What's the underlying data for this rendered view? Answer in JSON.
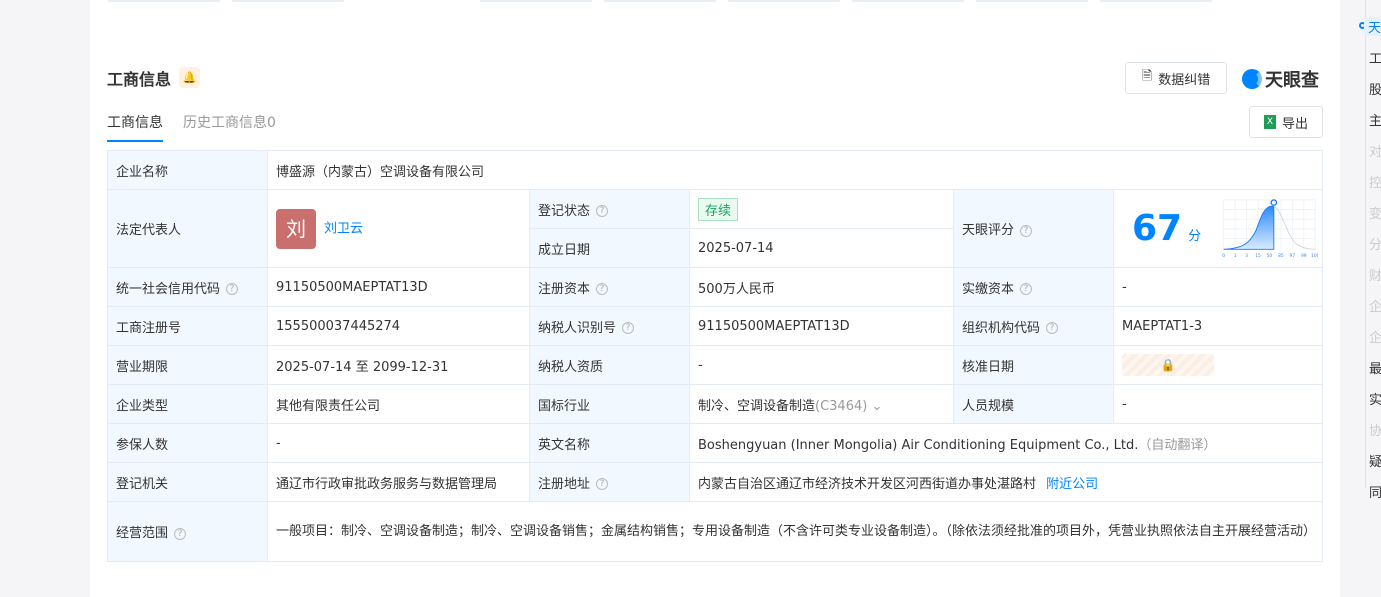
{
  "section": {
    "title": "工商信息",
    "correction_label": "数据纠错",
    "brand": "天眼查",
    "export_label": "导出"
  },
  "tabs": [
    {
      "label": "工商信息",
      "active": true
    },
    {
      "label": "历史工商信息0",
      "active": false
    }
  ],
  "info": {
    "company_name_label": "企业名称",
    "company_name": "博盛源（内蒙古）空调设备有限公司",
    "legal_rep_label": "法定代表人",
    "legal_rep_avatar": "刘",
    "legal_rep": "刘卫云",
    "reg_status_label": "登记状态",
    "reg_status": "存续",
    "found_date_label": "成立日期",
    "found_date": "2025-07-14",
    "score_label": "天眼评分",
    "score": "67",
    "score_unit": "分",
    "credit_code_label": "统一社会信用代码",
    "credit_code": "91150500MAEPTAT13D",
    "reg_capital_label": "注册资本",
    "reg_capital": "500万人民币",
    "paid_capital_label": "实缴资本",
    "paid_capital": "-",
    "reg_no_label": "工商注册号",
    "reg_no": "155500037445274",
    "taxpayer_id_label": "纳税人识别号",
    "taxpayer_id": "91150500MAEPTAT13D",
    "org_code_label": "组织机构代码",
    "org_code": "MAEPTAT1-3",
    "term_label": "营业期限",
    "term": "2025-07-14 至 2099-12-31",
    "taxpayer_qual_label": "纳税人资质",
    "taxpayer_qual": "-",
    "approve_date_label": "核准日期",
    "type_label": "企业类型",
    "type": "其他有限责任公司",
    "industry_label": "国标行业",
    "industry": "制冷、空调设备制造",
    "industry_code": "(C3464)",
    "staff_size_label": "人员规模",
    "staff_size": "-",
    "insured_label": "参保人数",
    "insured": "-",
    "en_name_label": "英文名称",
    "en_name": "Boshengyuan (Inner Mongolia) Air Conditioning Equipment Co., Ltd.",
    "en_note": "（自动翻译）",
    "authority_label": "登记机关",
    "authority": "通辽市行政审批政务服务与数据管理局",
    "address_label": "注册地址",
    "address": "内蒙古自治区通辽市经济技术开发区河西街道办事处湛路村",
    "nearby_link": "附近公司",
    "scope_label": "经营范围",
    "scope": "一般项目：制冷、空调设备制造；制冷、空调设备销售；金属结构销售；专用设备制造（不含许可类专业设备制造）。（除依法须经批准的项目外，凭营业执照依法自主开展经营活动）"
  },
  "score_chart": {
    "ticks": [
      "0",
      "1",
      "3",
      "15",
      "50",
      "85",
      "97",
      "99",
      "100"
    ]
  },
  "nav": [
    {
      "label": "天",
      "active": true
    },
    {
      "label": "工"
    },
    {
      "label": "股"
    },
    {
      "label": "主"
    },
    {
      "label": "对",
      "disabled": true
    },
    {
      "label": "控",
      "disabled": true
    },
    {
      "label": "变",
      "disabled": true
    },
    {
      "label": "分",
      "disabled": true
    },
    {
      "label": "财",
      "disabled": true
    },
    {
      "label": "企",
      "disabled": true
    },
    {
      "label": "企",
      "disabled": true
    },
    {
      "label": "最"
    },
    {
      "label": "实"
    },
    {
      "label": "协",
      "disabled": true
    },
    {
      "label": "疑"
    },
    {
      "label": "同"
    }
  ]
}
